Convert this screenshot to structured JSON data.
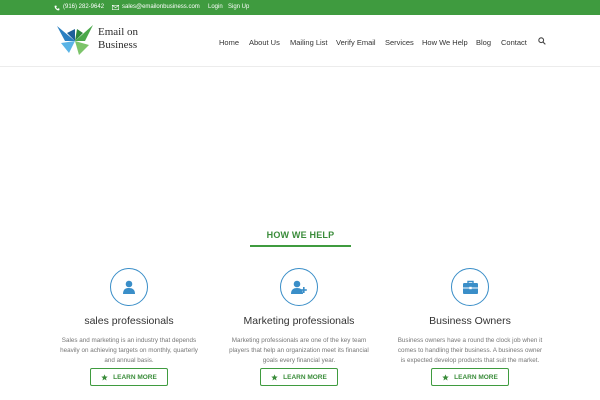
{
  "topbar": {
    "phone": "(916) 282-9642",
    "email": "sales@emailonbusiness.com",
    "login": "Login",
    "signup": "Sign Up",
    "icons": [
      "phone-icon",
      "envelope-icon"
    ]
  },
  "logo": {
    "line1": "Email on",
    "line2": "Business"
  },
  "nav": {
    "items": [
      "Home",
      "About Us",
      "Mailing List",
      "Verify Email",
      "Services",
      "How We Help",
      "Blog",
      "Contact"
    ]
  },
  "section": {
    "title": "HOW WE HELP"
  },
  "cards": [
    {
      "icon": "user-icon",
      "title": "sales professionals",
      "desc_lines": [
        "Sales and marketing is an industry that depends",
        "heavily on achieving targets on monthly, quarterly",
        "and annual basis."
      ],
      "button": "LEARN MORE"
    },
    {
      "icon": "user-add-icon",
      "title": "Marketing professionals",
      "desc_lines": [
        "Marketing professionals are one of the key team",
        "players that help an organization meet its financial",
        "goals every financial year."
      ],
      "button": "LEARN MORE"
    },
    {
      "icon": "briefcase-icon",
      "title": "Business Owners",
      "desc_lines": [
        "Business owners have a round the clock job when it",
        "comes to handling their business. A business owner",
        "is expected develop products that suit the market."
      ],
      "button": "LEARN MORE"
    }
  ],
  "colors": {
    "topbar": "#3f9b3f",
    "accent": "#3a8c3a",
    "icon_blue": "#3a8ec8"
  }
}
